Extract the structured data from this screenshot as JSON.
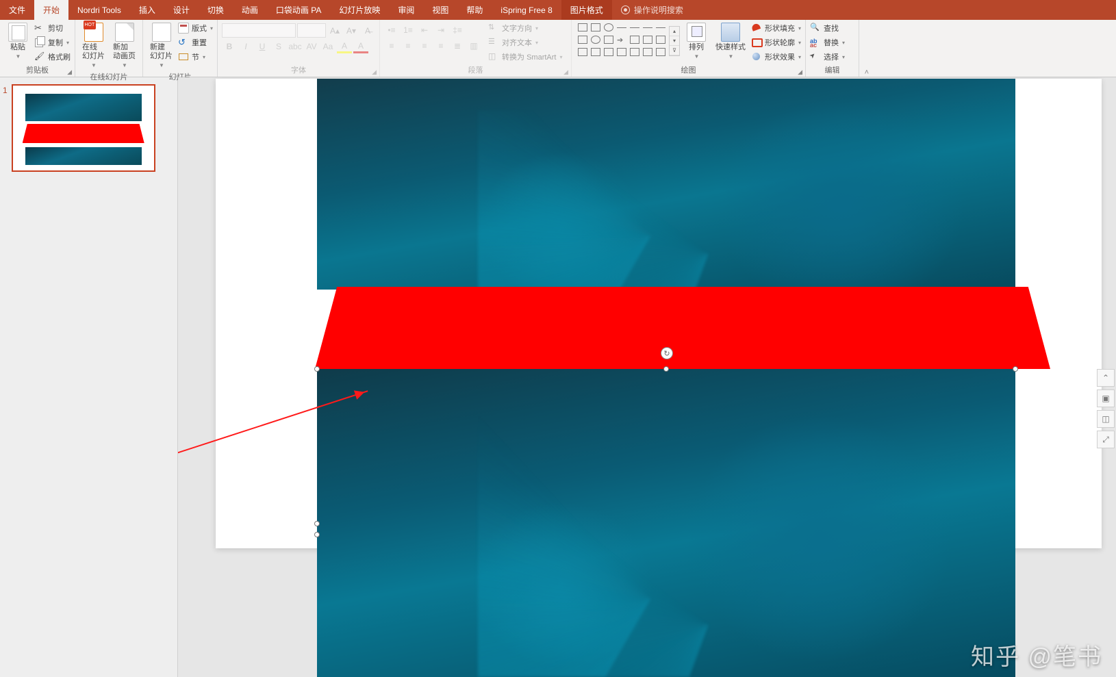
{
  "tabs": {
    "file": "文件",
    "home": "开始",
    "nordri": "Nordri Tools",
    "insert": "插入",
    "design": "设计",
    "transitions": "切换",
    "animations": "动画",
    "pocket": "口袋动画 PA",
    "slideshow": "幻灯片放映",
    "review": "审阅",
    "view": "视图",
    "help": "帮助",
    "ispring": "iSpring Free 8",
    "picture_format": "图片格式",
    "search": "操作说明搜索"
  },
  "clipboard": {
    "paste": "粘贴",
    "cut": "剪切",
    "copy": "复制",
    "format_painter": "格式刷",
    "group_label": "剪贴板"
  },
  "online_slides": {
    "online": "在线\n幻灯片",
    "new_page": "新加\n动画页",
    "group_label": "在线幻灯片"
  },
  "slides": {
    "new_slide": "新建\n幻灯片",
    "layout": "版式",
    "reset": "重置",
    "section": "节",
    "group_label": "幻灯片"
  },
  "font": {
    "group_label": "字体"
  },
  "paragraph": {
    "text_direction": "文字方向",
    "align_text": "对齐文本",
    "smartart": "转换为 SmartArt",
    "group_label": "段落"
  },
  "drawing": {
    "arrange": "排列",
    "quick_styles": "快速样式",
    "fill": "形状填充",
    "outline": "形状轮廓",
    "effects": "形状效果",
    "group_label": "绘图"
  },
  "editing": {
    "find": "查找",
    "replace": "替换",
    "select": "选择",
    "group_label": "编辑"
  },
  "thumbs": {
    "slide1_num": "1"
  },
  "watermark": "知乎 @笔书"
}
